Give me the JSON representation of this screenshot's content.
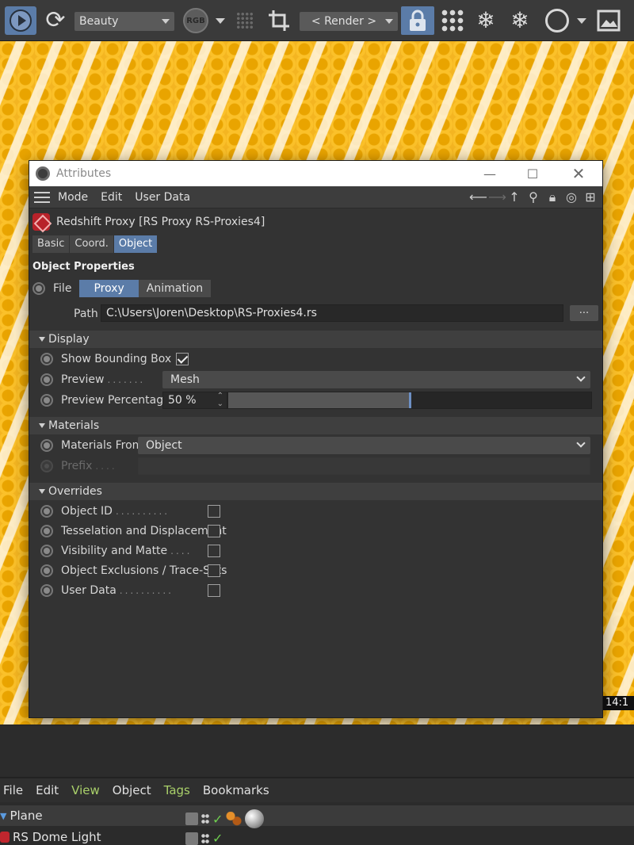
{
  "toolbar": {
    "pass_select": "Beauty",
    "rgb_label": "RGB",
    "render_select": "< Render >",
    "colors": {
      "accent": "#5b7ca8",
      "bar": "#3a3a3a"
    }
  },
  "viewport": {
    "time_display": "14:1"
  },
  "window": {
    "title": "Attributes",
    "menu": [
      "Mode",
      "Edit",
      "User Data"
    ],
    "object_header": "Redshift Proxy [RS Proxy RS-Proxies4]",
    "tabs": [
      "Basic",
      "Coord.",
      "Object"
    ],
    "active_tab": "Object",
    "section_title": "Object Properties",
    "file_label": "File",
    "file_modes": [
      "Proxy",
      "Animation"
    ],
    "path_label": "Path",
    "path_value": "C:\\Users\\Joren\\Desktop\\RS-Proxies4.rs",
    "browse_label": "...",
    "display": {
      "title": "Display",
      "show_bbox_label": "Show Bounding Box",
      "show_bbox_checked": true,
      "preview_label": "Preview",
      "preview_value": "Mesh",
      "preview_pct_label": "Preview Percentage",
      "preview_pct_value": "50 %",
      "preview_pct_fraction": 0.5
    },
    "materials": {
      "title": "Materials",
      "from_label": "Materials From",
      "from_value": "Object",
      "prefix_label": "Prefix",
      "prefix_value": ""
    },
    "overrides": {
      "title": "Overrides",
      "items": [
        {
          "label": "Object ID",
          "checked": false
        },
        {
          "label": "Tesselation and Displacement",
          "checked": false
        },
        {
          "label": "Visibility and Matte",
          "checked": false
        },
        {
          "label": "Object Exclusions / Trace-Sets",
          "checked": false
        },
        {
          "label": "User Data",
          "checked": false
        }
      ]
    }
  },
  "object_manager": {
    "menu": [
      "File",
      "Edit",
      "View",
      "Object",
      "Tags",
      "Bookmarks"
    ],
    "rows": [
      {
        "name": "Plane"
      },
      {
        "name": "RS Dome Light"
      }
    ]
  }
}
